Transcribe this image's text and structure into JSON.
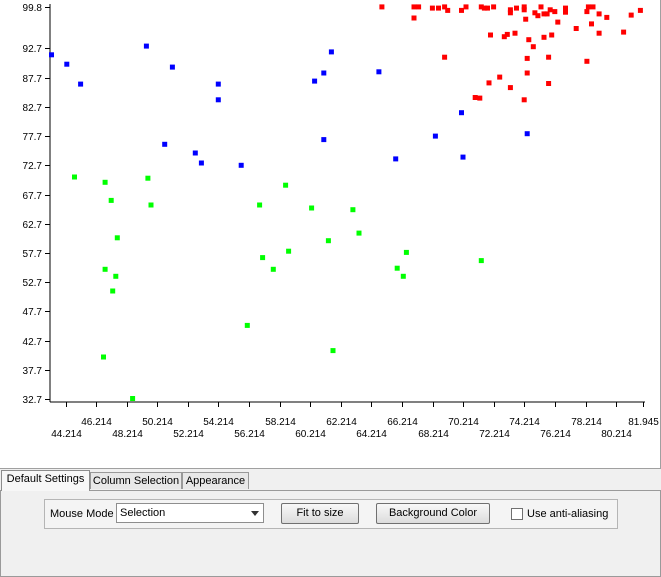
{
  "chart_data": {
    "type": "scatter",
    "xlim": [
      43.2,
      82.1
    ],
    "ylim": [
      32.2,
      100.3
    ],
    "x_ticks_upper": [
      "46.214",
      "50.214",
      "54.214",
      "58.214",
      "62.214",
      "66.214",
      "70.214",
      "74.214",
      "78.214",
      "81.945"
    ],
    "x_ticks_lower": [
      "44.214",
      "48.214",
      "52.214",
      "56.214",
      "60.214",
      "64.214",
      "68.214",
      "72.214",
      "76.214",
      "80.214"
    ],
    "x_tick_values_upper": [
      46.214,
      50.214,
      54.214,
      58.214,
      62.214,
      66.214,
      70.214,
      74.214,
      78.214,
      81.945
    ],
    "x_tick_values_lower": [
      44.214,
      48.214,
      52.214,
      56.214,
      60.214,
      64.214,
      68.214,
      72.214,
      76.214,
      80.214
    ],
    "y_ticks": [
      "99.8",
      "92.7",
      "87.7",
      "82.7",
      "77.7",
      "72.7",
      "67.7",
      "62.7",
      "57.7",
      "52.7",
      "47.7",
      "42.7",
      "37.7",
      "32.7"
    ],
    "y_tick_values": [
      99.8,
      92.7,
      87.7,
      82.7,
      77.7,
      72.7,
      67.7,
      62.7,
      57.7,
      52.7,
      47.7,
      42.7,
      37.7,
      32.7
    ],
    "grid": false,
    "series": [
      {
        "color": "#ff0000",
        "points": [
          [
            64.9,
            99.8
          ],
          [
            67.0,
            99.8
          ],
          [
            67.3,
            99.8
          ],
          [
            68.2,
            99.6
          ],
          [
            68.6,
            99.6
          ],
          [
            69.0,
            99.8
          ],
          [
            70.4,
            99.8
          ],
          [
            71.4,
            99.8
          ],
          [
            71.6,
            99.6
          ],
          [
            72.2,
            99.8
          ],
          [
            73.7,
            99.6
          ],
          [
            74.2,
            99.8
          ],
          [
            75.3,
            99.8
          ],
          [
            76.9,
            99.6
          ],
          [
            78.4,
            99.8
          ],
          [
            78.7,
            99.8
          ],
          [
            81.8,
            99.2
          ],
          [
            69.2,
            99.2
          ],
          [
            70.1,
            99.2
          ],
          [
            71.8,
            99.6
          ],
          [
            73.3,
            99.3
          ],
          [
            74.2,
            99.3
          ],
          [
            74.9,
            98.8
          ],
          [
            75.5,
            98.6
          ],
          [
            75.9,
            99.3
          ],
          [
            76.2,
            99.0
          ],
          [
            79.1,
            98.6
          ],
          [
            79.6,
            98.0
          ],
          [
            81.2,
            98.4
          ],
          [
            78.3,
            99.0
          ],
          [
            67.0,
            97.9
          ],
          [
            73.3,
            98.8
          ],
          [
            74.3,
            97.7
          ],
          [
            75.1,
            98.3
          ],
          [
            75.7,
            98.6
          ],
          [
            76.4,
            97.2
          ],
          [
            76.9,
            98.9
          ],
          [
            78.6,
            96.9
          ],
          [
            79.1,
            95.3
          ],
          [
            72.0,
            95.0
          ],
          [
            72.9,
            94.7
          ],
          [
            73.1,
            95.1
          ],
          [
            73.6,
            95.3
          ],
          [
            74.5,
            94.2
          ],
          [
            74.8,
            93.0
          ],
          [
            75.5,
            94.6
          ],
          [
            76.0,
            95.0
          ],
          [
            77.6,
            96.1
          ],
          [
            80.7,
            95.5
          ],
          [
            69.0,
            91.2
          ],
          [
            74.4,
            91.0
          ],
          [
            75.8,
            91.2
          ],
          [
            78.3,
            90.5
          ],
          [
            71.9,
            86.8
          ],
          [
            72.6,
            87.8
          ],
          [
            73.3,
            86.0
          ],
          [
            74.4,
            88.5
          ],
          [
            75.8,
            86.7
          ],
          [
            71.0,
            84.3
          ],
          [
            71.3,
            84.2
          ],
          [
            74.2,
            83.9
          ]
        ]
      },
      {
        "color": "#0000ff",
        "points": [
          [
            43.3,
            91.6
          ],
          [
            44.3,
            90.0
          ],
          [
            45.2,
            86.6
          ],
          [
            49.5,
            93.1
          ],
          [
            50.7,
            76.3
          ],
          [
            51.2,
            89.5
          ],
          [
            52.7,
            74.8
          ],
          [
            53.1,
            73.1
          ],
          [
            54.2,
            86.6
          ],
          [
            54.2,
            83.9
          ],
          [
            55.7,
            72.7
          ],
          [
            60.5,
            87.1
          ],
          [
            61.1,
            88.5
          ],
          [
            61.1,
            77.1
          ],
          [
            61.6,
            92.1
          ],
          [
            64.7,
            88.7
          ],
          [
            65.8,
            73.8
          ],
          [
            68.4,
            77.7
          ],
          [
            70.1,
            81.7
          ],
          [
            70.2,
            74.1
          ],
          [
            74.4,
            78.1
          ]
        ]
      },
      {
        "color": "#00ff00",
        "points": [
          [
            44.8,
            70.7
          ],
          [
            46.8,
            69.8
          ],
          [
            47.2,
            66.7
          ],
          [
            47.6,
            60.3
          ],
          [
            47.5,
            53.7
          ],
          [
            46.8,
            54.9
          ],
          [
            47.3,
            51.2
          ],
          [
            49.6,
            70.5
          ],
          [
            49.8,
            65.9
          ],
          [
            46.7,
            39.9
          ],
          [
            48.6,
            32.8
          ],
          [
            56.1,
            45.3
          ],
          [
            56.9,
            65.9
          ],
          [
            57.1,
            56.9
          ],
          [
            57.8,
            54.9
          ],
          [
            58.6,
            69.3
          ],
          [
            58.8,
            58.0
          ],
          [
            60.3,
            65.4
          ],
          [
            61.4,
            59.8
          ],
          [
            61.7,
            41.0
          ],
          [
            63.0,
            65.1
          ],
          [
            63.4,
            61.1
          ],
          [
            65.9,
            55.1
          ],
          [
            66.3,
            53.7
          ],
          [
            66.5,
            57.8
          ],
          [
            71.4,
            56.4
          ]
        ]
      }
    ]
  },
  "tabs": [
    {
      "label": "Default Settings"
    },
    {
      "label": "Column Selection"
    },
    {
      "label": "Appearance"
    }
  ],
  "controls": {
    "mouse_mode_label": "Mouse Mode",
    "mouse_mode_value": "Selection",
    "fit_button": "Fit to size",
    "bg_button": "Background Color",
    "antialias_label": "Use anti-aliasing"
  }
}
